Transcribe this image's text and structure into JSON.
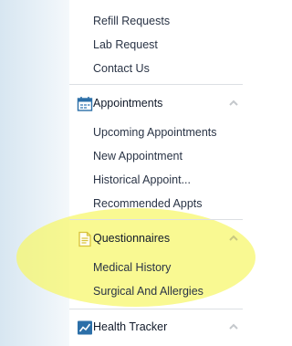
{
  "menu": {
    "top_links": [
      "Refill Requests",
      "Lab Request",
      "Contact Us"
    ],
    "appointments": {
      "title": "Appointments",
      "items": [
        "Upcoming Appointments",
        "New Appointment",
        "Historical Appoint...",
        "Recommended Appts"
      ]
    },
    "questionnaires": {
      "title": "Questionnaires",
      "items": [
        "Medical History",
        "Surgical And Allergies"
      ]
    },
    "health_tracker": {
      "title": "Health Tracker"
    }
  },
  "colors": {
    "highlight": "#f6f668",
    "icon_blue": "#2c6fa8",
    "icon_yellow": "#d8c23a",
    "text": "#2a3446"
  },
  "icons": {
    "appointments": "calendar-icon",
    "questionnaires": "document-icon",
    "health_tracker": "chart-icon",
    "collapse": "chevron-up-icon"
  }
}
